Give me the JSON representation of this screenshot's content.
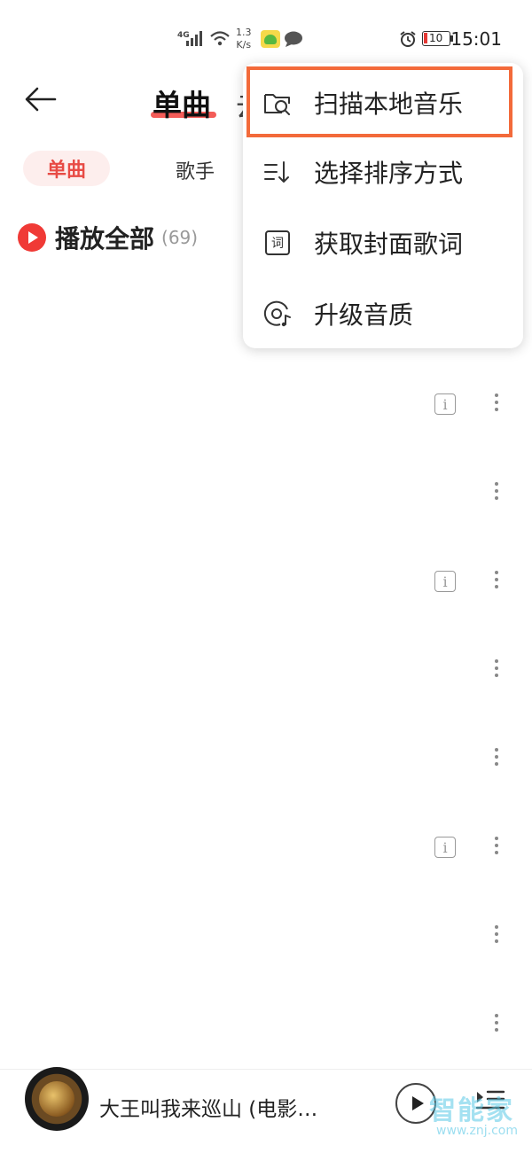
{
  "status_bar": {
    "network": "4G",
    "speed": "1.3",
    "speed_unit": "K/s",
    "battery": "10",
    "time": "15:01"
  },
  "header": {
    "title": "单曲",
    "next_tab_partial": "云"
  },
  "subtabs": {
    "active": "单曲",
    "second": "歌手"
  },
  "play_all": {
    "label": "播放全部",
    "count": "(69)"
  },
  "menu": {
    "items": [
      {
        "label": "扫描本地音乐",
        "icon": "folder-search-icon"
      },
      {
        "label": "选择排序方式",
        "icon": "sort-icon"
      },
      {
        "label": "获取封面歌词",
        "icon": "lyrics-icon",
        "icon_text": "词"
      },
      {
        "label": "升级音质",
        "icon": "disc-quality-icon"
      }
    ],
    "highlight_color": "#f36a3a"
  },
  "rows": {
    "info_symbol": "i"
  },
  "player": {
    "song_title": "大王叫我来巡山 (电影…"
  },
  "watermark": {
    "text": "智能家",
    "url": "www.znj.com"
  },
  "colors": {
    "accent": "#e84b45",
    "play_red": "#f03a36"
  }
}
